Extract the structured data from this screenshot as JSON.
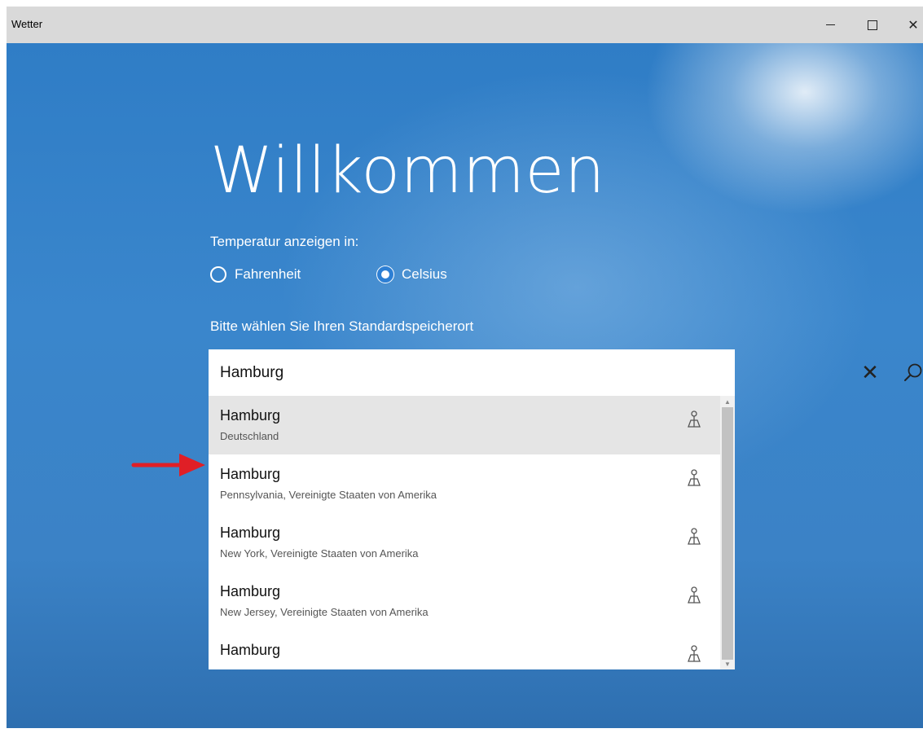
{
  "window": {
    "title": "Wetter"
  },
  "welcome": {
    "heading": "Willkommen"
  },
  "temperature": {
    "label": "Temperatur anzeigen in:",
    "options": [
      {
        "label": "Fahrenheit",
        "selected": false
      },
      {
        "label": "Celsius",
        "selected": true
      }
    ]
  },
  "location": {
    "label": "Bitte wählen Sie Ihren Standardspeicherort",
    "search_value": "Hamburg",
    "results": [
      {
        "name": "Hamburg",
        "detail": "Deutschland",
        "selected": true
      },
      {
        "name": "Hamburg",
        "detail": "Pennsylvania, Vereinigte Staaten von Amerika",
        "selected": false
      },
      {
        "name": "Hamburg",
        "detail": "New York, Vereinigte Staaten von Amerika",
        "selected": false
      },
      {
        "name": "Hamburg",
        "detail": "New Jersey, Vereinigte Staaten von Amerika",
        "selected": false
      },
      {
        "name": "Hamburg",
        "detail": "",
        "selected": false
      }
    ]
  },
  "icons": {
    "minimize": "minimize-icon",
    "maximize": "maximize-icon",
    "close": "close-icon",
    "clear": "clear-icon",
    "search": "search-icon",
    "pin": "location-pin-icon",
    "arrow": "annotation-arrow"
  },
  "colors": {
    "accent": "#2d7fd4",
    "background": "#3a86cc",
    "annotation_arrow": "#e01f26"
  }
}
